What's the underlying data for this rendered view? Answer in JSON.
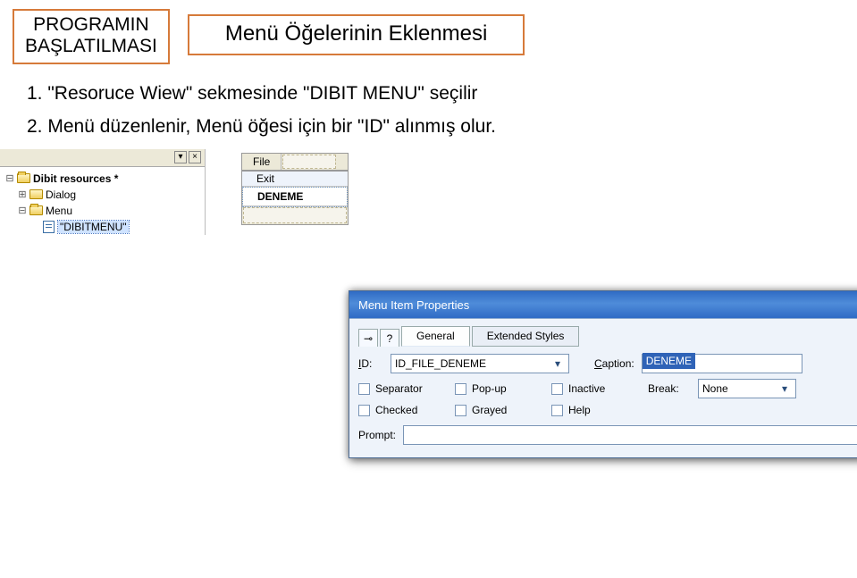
{
  "header": {
    "badge_line1": "PROGRAMIN",
    "badge_line2": "BAŞLATILMASI",
    "title": "Menü Öğelerinin Eklenmesi"
  },
  "steps": {
    "s1": "1. \"Resoruce Wiew\" sekmesinde \"DIBIT MENU\" seçilir",
    "s2": "2. Menü düzenlenir, Menü öğesi için bir \"ID\" alınmış olur."
  },
  "tree": {
    "root": "Dibit resources *",
    "dialog": "Dialog",
    "menu": "Menu",
    "menu_item": "\"DIBITMENU\""
  },
  "editor": {
    "menu_caption": "File",
    "item_exit": "Exit",
    "item_deneme": "DENEME"
  },
  "dlg": {
    "title": "Menu Item Properties",
    "tab_general": "General",
    "tab_ext": "Extended Styles",
    "lbl_id": "ID:",
    "id_value": "ID_FILE_DENEME",
    "lbl_caption": "Caption:",
    "caption_value": "DENEME",
    "chk_separator": "Separator",
    "chk_popup": "Pop-up",
    "chk_inactive": "Inactive",
    "lbl_break": "Break:",
    "break_value": "None",
    "chk_checked": "Checked",
    "chk_grayed": "Grayed",
    "chk_help": "Help",
    "lbl_prompt": "Prompt:"
  }
}
